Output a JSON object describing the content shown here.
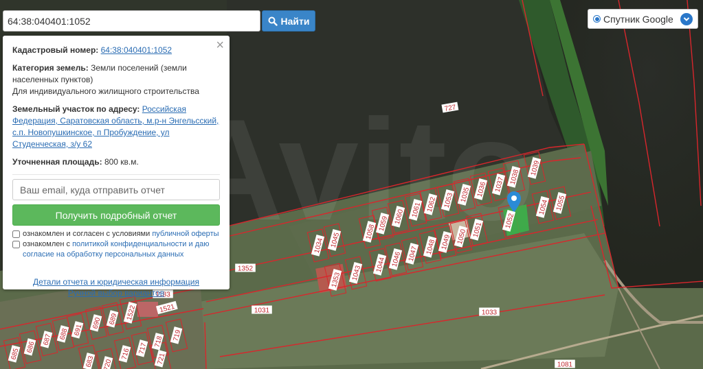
{
  "search": {
    "value": "64:38:040401:1052",
    "button_label": "Найти"
  },
  "layer": {
    "label": "Спутник Google"
  },
  "panel": {
    "cadastral_label": "Кадастровый номер:",
    "cadastral_value": "64:38:040401:1052",
    "category_label": "Категория земель:",
    "category_value": "Земли поселений (земли населенных пунктов)",
    "use_value": "Для индивидуального жилищного строительства",
    "address_label": "Земельный участок по адресу:",
    "address_value": "Российская Федерация, Саратовская область, м.р-н Энгельсский, с.п. Новопушкинское, п Пробуждение, ул Студенческая, з/у 62",
    "area_label": "Уточненная площадь:",
    "area_value": "800 кв.м.",
    "email_placeholder": "Ваш email, куда отправить отчет",
    "report_button": "Получить подробный отчет",
    "consent1_prefix": "ознакомлен и согласен с условиями",
    "consent1_link": "публичной оферты",
    "consent2_prefix": "ознакомлен с",
    "consent2_link": "политикой конфиденциальности и даю согласие на обработку персональных данных",
    "details_link": "Детали отчета и юридическая информация",
    "manual_link": "Ручной выбор вариантов"
  },
  "map": {
    "watermark": "Avito",
    "parcel_labels": [
      "727",
      "1039",
      "1038",
      "1037",
      "1036",
      "1035",
      "1053",
      "1052",
      "1054",
      "1055",
      "1062",
      "1061",
      "1060",
      "1059",
      "1058",
      "1045",
      "1034",
      "1051",
      "1050",
      "1049",
      "1048",
      "1047",
      "1046",
      "1044",
      "1043",
      "1353",
      "1352",
      "1031",
      "1033",
      "1081",
      "1183",
      "1521",
      "1522",
      "689",
      "690",
      "691",
      "688",
      "687",
      "686",
      "685",
      "683",
      "716",
      "717",
      "718",
      "719",
      "721",
      "720",
      "715"
    ]
  },
  "colors": {
    "accent": "#3a85c8",
    "success": "#5cb85c",
    "parcel_border": "#d9262c",
    "selected_parcel": "#39b54a"
  }
}
